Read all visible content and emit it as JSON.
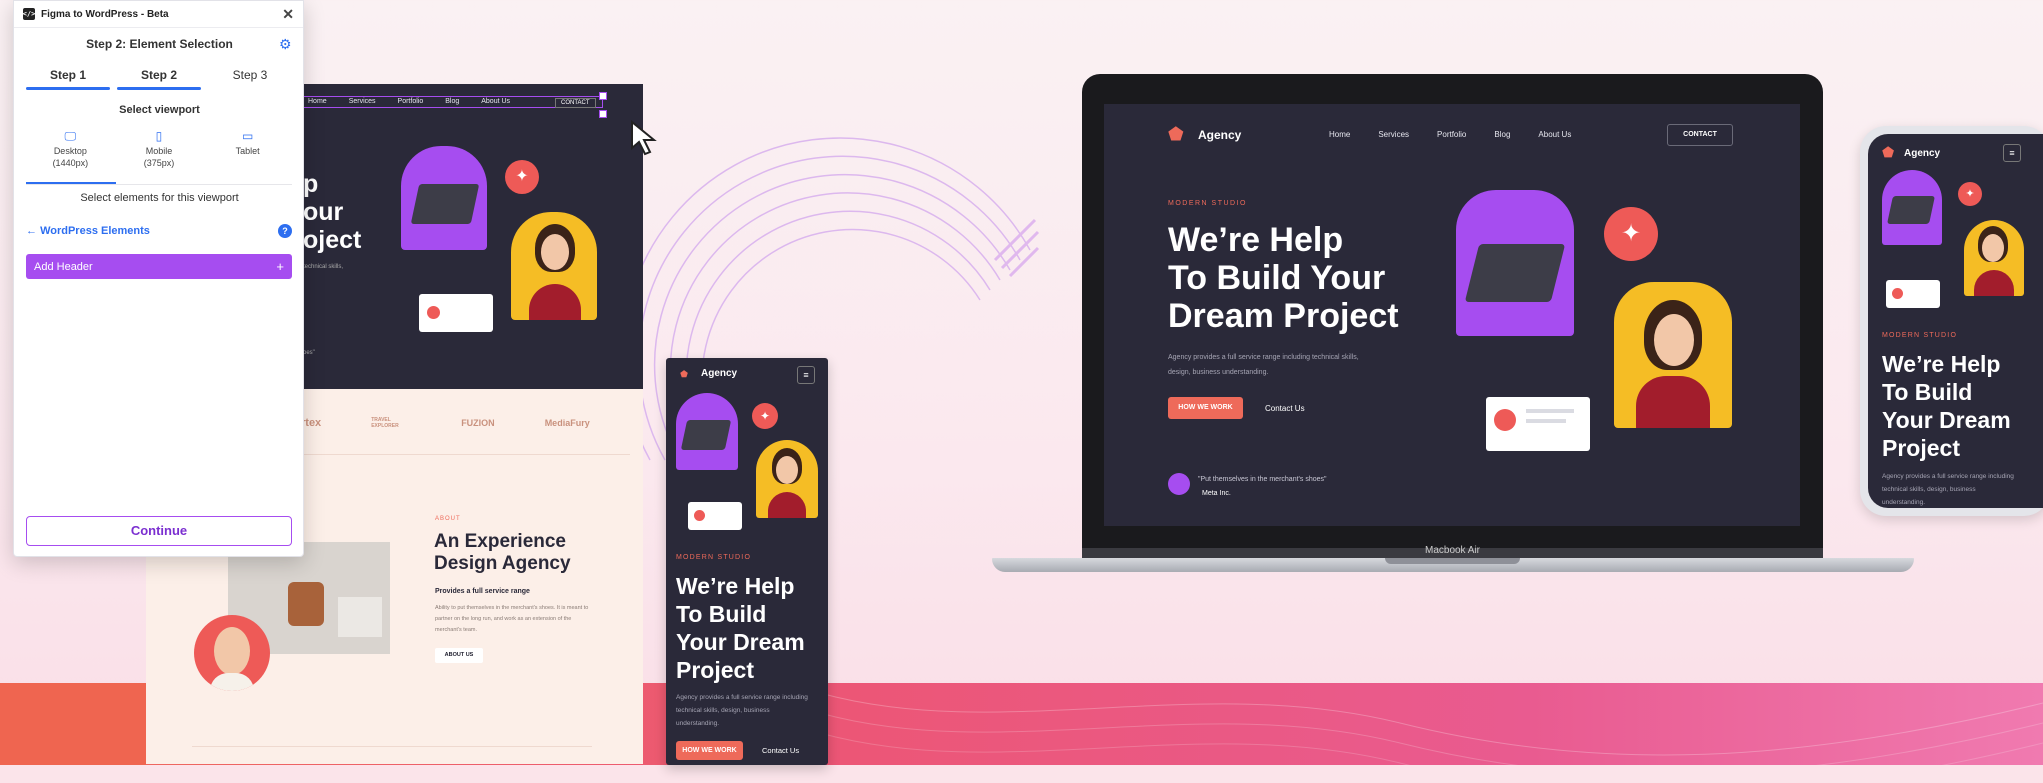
{
  "plugin": {
    "title": "Figma to WordPress - Beta",
    "step_title": "Step 2: Element Selection",
    "steps": [
      {
        "label": "Step 1"
      },
      {
        "label": "Step 2"
      },
      {
        "label": "Step 3"
      }
    ],
    "viewport_label": "Select viewport",
    "viewports": [
      {
        "name": "Desktop",
        "size": "(1440px)"
      },
      {
        "name": "Mobile",
        "size": "(375px)"
      },
      {
        "name": "Tablet",
        "size": ""
      }
    ],
    "select_text": "Select elements for this viewport",
    "back_label": "WordPress Elements",
    "help": "?",
    "add_header": "Add Header",
    "continue": "Continue",
    "accent": "#2d6ef0",
    "button_color": "#a64df0"
  },
  "site": {
    "brand": "Agency",
    "nav": [
      "Home",
      "Services",
      "Portfolio",
      "Blog",
      "About Us"
    ],
    "contact": "CONTACT",
    "eyebrow": "MODERN STUDIO",
    "headline_lines": [
      "We’re Help",
      "To Build Your",
      "Dream Project"
    ],
    "mobile_headline_lines": [
      "We’re Help",
      "To Build",
      "Your Dream",
      "Project"
    ],
    "phone_headline_lines": [
      "We’re Help",
      "To Build",
      "Your Dream",
      "Project"
    ],
    "desc_lines": [
      "Agency provides a full service range including technical skills,",
      "design, business understanding."
    ],
    "mobile_desc_lines": [
      "Agency provides a full service range including",
      "technical skills, design, business",
      "understanding."
    ],
    "phone_desc_lines": [
      "Agency provides a full service range including",
      "technical skills, design, business",
      "understanding."
    ],
    "cta_primary": "HOW WE WORK",
    "cta_secondary": "Contact Us",
    "quote": "\"Put themselves in the merchant's shoes\"",
    "quote_author": "Meta Inc.",
    "partial_hero": [
      "p",
      "our",
      "oject"
    ],
    "partial_desc": "technical skills,",
    "partial_quote": "oes\"",
    "logos": [
      "rtex",
      "TRAVEL EXPLORER",
      "FUZION",
      "MediaFury"
    ],
    "about_eyebrow": "ABOUT",
    "about_title_lines": [
      "An Experience",
      "Design Agency"
    ],
    "about_sub": "Provides a full service range",
    "about_body_lines": [
      "Ability to put themselves in the merchant's shoes. It is meant to",
      "partner on the long run, and work as an extension of the",
      "merchant's team."
    ],
    "about_button": "ABOUT US",
    "colors": {
      "dark": "#2a2939",
      "coral": "#ee6a5a",
      "purple": "#a64df0",
      "yellow": "#f5bd25"
    }
  },
  "laptop": {
    "label": "Macbook Air"
  },
  "menu_icon": "hamburger-icon"
}
